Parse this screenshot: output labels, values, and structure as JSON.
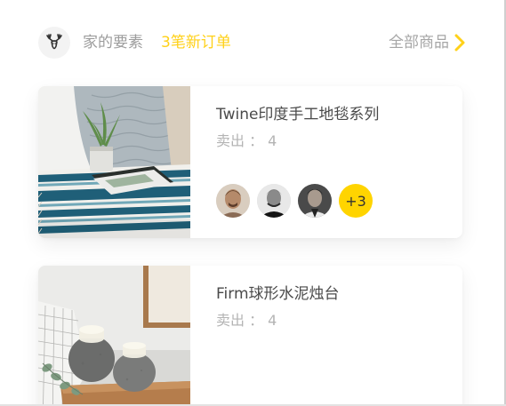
{
  "header": {
    "logo_icon": "deer-antler-icon",
    "shop_name": "家的要素",
    "new_orders": "3笔新订单",
    "all_goods_label": "全部商品",
    "accent_color": "#ffd119"
  },
  "products": [
    {
      "title": "Twine印度手工地毯系列",
      "sold": "卖出 ： 4",
      "buyers_more": "+3",
      "image": "rug-with-plant-photo"
    },
    {
      "title": "Firm球形水泥烛台",
      "sold": "卖出 ： 4",
      "image": "concrete-candle-holder-photo"
    }
  ]
}
